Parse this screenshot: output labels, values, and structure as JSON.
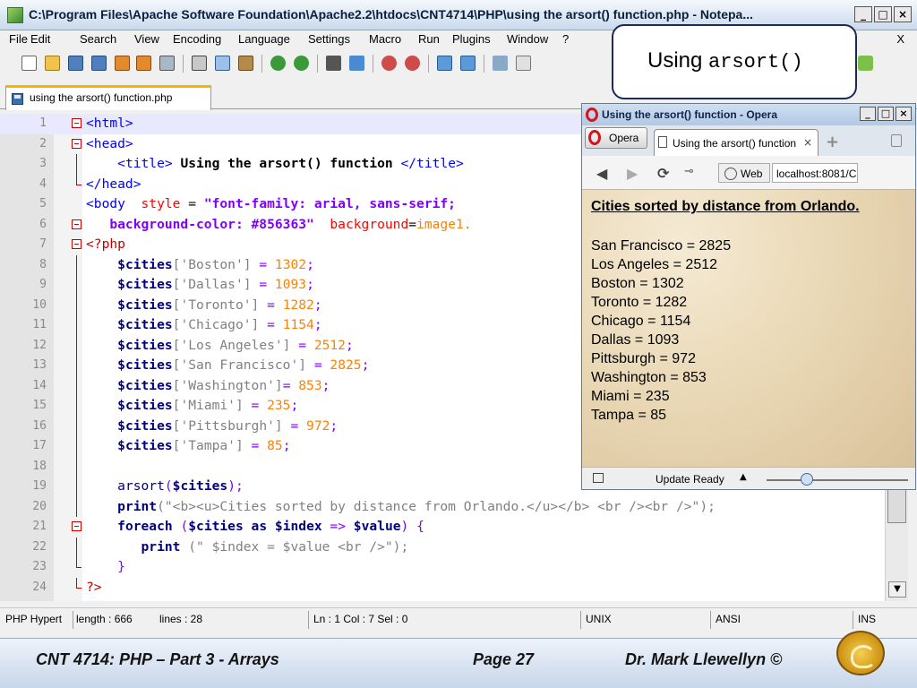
{
  "npp": {
    "title": "C:\\Program Files\\Apache Software Foundation\\Apache2.2\\htdocs\\CNT4714\\PHP\\using the arsort() function.php - Notepa...",
    "menu": [
      "File",
      "Edit",
      "Search",
      "View",
      "Encoding",
      "Language",
      "Settings",
      "Macro",
      "Run",
      "Plugins",
      "Window",
      "?"
    ],
    "menu_close": "X",
    "tab_label": "using the arsort() function.php",
    "status": {
      "lang": "PHP Hypert",
      "length": "length : 666",
      "lines": "lines : 28",
      "pos": "Ln : 1   Col : 7   Sel : 0",
      "eol": "UNIX",
      "enc": "ANSI",
      "mode": "INS"
    },
    "line_numbers": [
      "1",
      "2",
      "3",
      "4",
      "5",
      "6",
      "7",
      "8",
      "9",
      "10",
      "11",
      "12",
      "13",
      "14",
      "15",
      "16",
      "17",
      "18",
      "19",
      "20",
      "21",
      "22",
      "23",
      "24"
    ]
  },
  "code": {
    "l1_a": "<html>",
    "l2_a": "<head>",
    "l3_a": "<title>",
    "l3_b": " Using the arsort() function ",
    "l3_c": "</title>",
    "l4_a": "</head>",
    "l5_a": "<body",
    "l5_b": "  style",
    "l5_c": " = ",
    "l5_d": "\"font-family: arial, sans-serif;",
    "l6_a": "background-color: #856363\"",
    "l6_b": "  background",
    "l6_c": "=",
    "l6_d": "image1.",
    "l7_a": "<?php",
    "cities_var": "$cities",
    "l8_key": "['Boston']",
    "l8_val": "1302",
    "l9_key": "['Dallas']",
    "l9_val": "1093",
    "l10_key": "['Toronto']",
    "l10_val": "1282",
    "l11_key": "['Chicago']",
    "l11_val": "1154",
    "l12_key": "['Los Angeles']",
    "l12_val": "2512",
    "l13_key": "['San Francisco']",
    "l13_val": "2825",
    "l14_key": "['Washington']",
    "l14_val": "853",
    "l15_key": "['Miami']",
    "l15_val": "235",
    "l16_key": "['Pittsburgh']",
    "l16_val": "972",
    "l17_key": "['Tampa']",
    "l17_val": "85",
    "eq": " = ",
    "eq_tight": "= ",
    "semi": ";",
    "l19_fn": "arsort",
    "l19_open": "(",
    "l19_close": ");",
    "l20_fn": "print",
    "l20_str": "(\"<b><u>Cities sorted by distance from Orlando.</u></b> <br /><br />\");",
    "l21_kw": "foreach",
    "l21_a": " (",
    "l21_as": " as ",
    "l21_index": "$index",
    "l21_arrow": " => ",
    "l21_value": "$value",
    "l21_end": ") {",
    "l22_fn": "print",
    "l22_str": " (\" $index = $value <br />\");",
    "l23": "}",
    "l24": "?>"
  },
  "callout": {
    "prefix": "Using ",
    "code": "arsort()"
  },
  "opera": {
    "title": "Using the arsort() function - Opera",
    "menu_label": "Opera",
    "tab_label": "Using the arsort() function",
    "tab_close": "×",
    "new_tab": "+",
    "web_label": "Web",
    "url": "localhost:8081/C",
    "heading": "Cities sorted by distance from Orlando.",
    "cities": [
      "San Francisco = 2825",
      "Los Angeles = 2512",
      "Boston = 1302",
      "Toronto = 1282",
      "Chicago = 1154",
      "Dallas = 1093",
      "Pittsburgh = 972",
      "Washington = 853",
      "Miami = 235",
      "Tampa = 85"
    ],
    "status_text": "Update Ready"
  },
  "footer": {
    "course": "CNT 4714:  PHP – Part 3 - Arrays",
    "page": "Page 27",
    "author": "Dr. Mark Llewellyn ©"
  },
  "icons": {
    "app": "notepad-plus-plus-icon",
    "opera": "opera-logo-icon",
    "footer_logo": "ucf-pegasus-logo"
  }
}
